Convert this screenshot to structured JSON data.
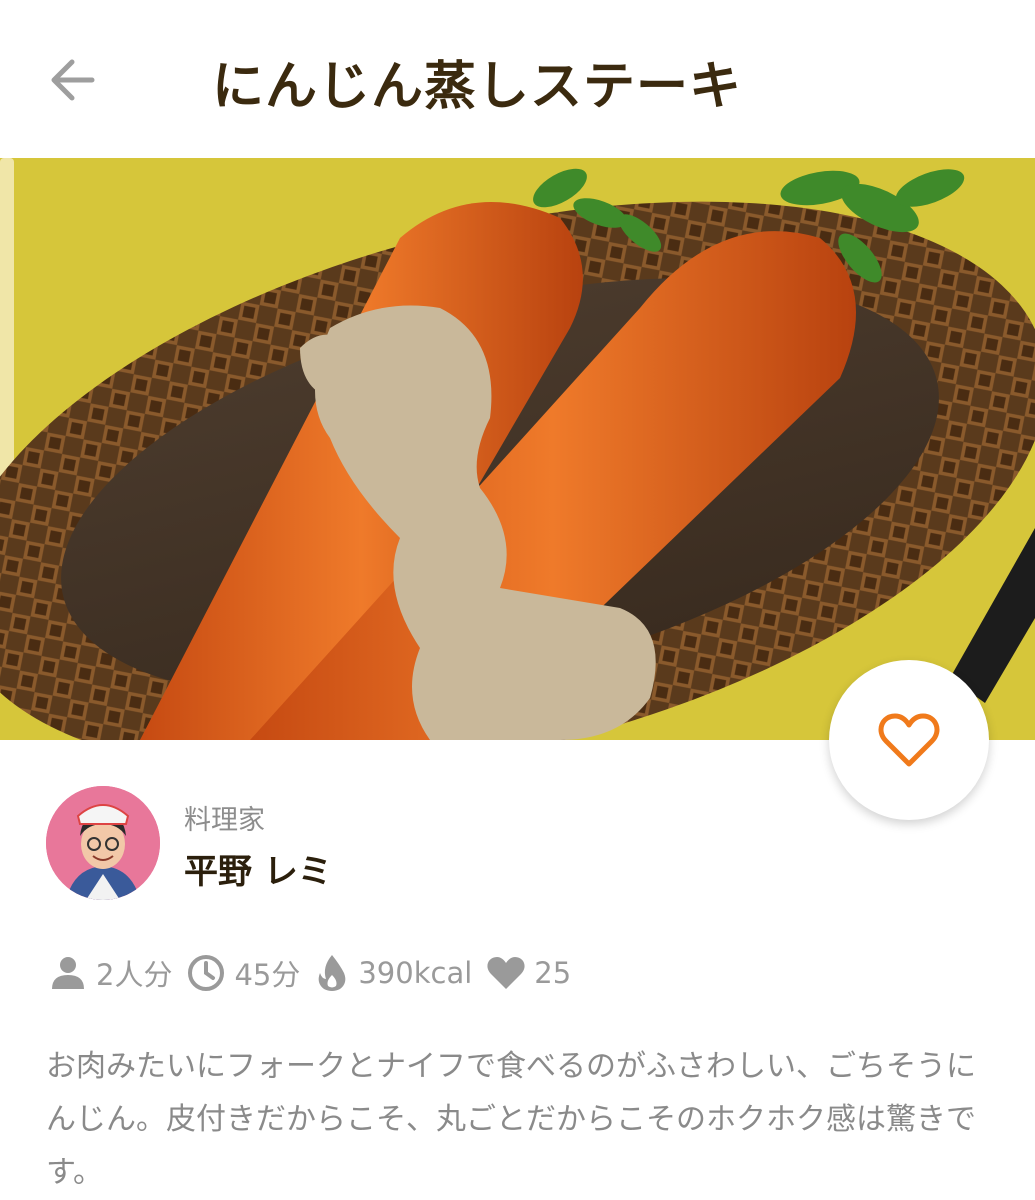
{
  "header": {
    "title": "にんじん蒸しステーキ",
    "back_icon": "arrow-left-icon"
  },
  "hero": {
    "image_alt": "にんじん蒸しステーキ"
  },
  "favorite": {
    "icon": "heart-outline-icon",
    "accent_color": "#f07a1b"
  },
  "author": {
    "role": "料理家",
    "name": "平野 レミ",
    "avatar_bg": "#e8779a"
  },
  "meta": {
    "servings": "2人分",
    "time": "45分",
    "calories": "390kcal",
    "likes": "25",
    "icon_color": "#9a9a9a"
  },
  "description": "お肉みたいにフォークとナイフで食べるのがふさわしい、ごちそうにんじん。皮付きだからこそ、丸ごとだからこそのホクホク感は驚きです。"
}
